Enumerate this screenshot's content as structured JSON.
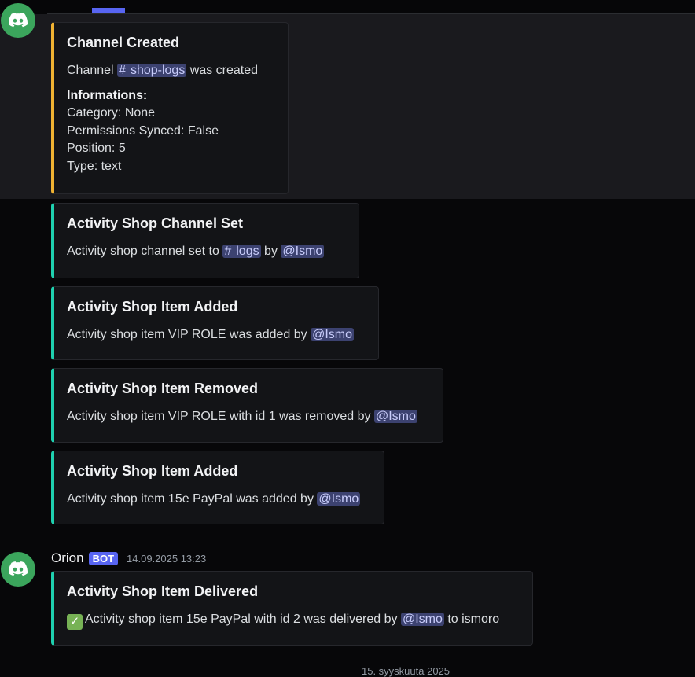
{
  "embeds": [
    {
      "title": "Channel Created",
      "desc_pre": "Channel ",
      "channel": "shop-logs",
      "desc_post": " was created",
      "field_name": "Informations:",
      "field_lines": [
        "Category: None",
        "Permissions Synced: False",
        "Position: 5",
        "Type: text"
      ]
    },
    {
      "title": "Activity Shop Channel Set",
      "desc_pre": "Activity shop channel set to ",
      "channel": "logs",
      "desc_mid": " by ",
      "mention": "@Ismo"
    },
    {
      "title": "Activity Shop Item Added",
      "desc_pre": "Activity shop item VIP ROLE was added by ",
      "mention": "@Ismo"
    },
    {
      "title": "Activity Shop Item Removed",
      "desc_pre": "Activity shop item VIP ROLE with id 1 was removed by ",
      "mention": "@Ismo"
    },
    {
      "title": "Activity Shop Item Added",
      "desc_pre": "Activity shop item 15e PayPal was added by ",
      "mention": "@Ismo"
    }
  ],
  "message": {
    "username": "Orion",
    "bot_tag": "BOT",
    "timestamp": "14.09.2025 13:23",
    "embed": {
      "title": "Activity Shop Item Delivered",
      "check_glyph": "✓",
      "desc_pre": "Activity shop item 15e PayPal with id 2 was delivered by ",
      "mention": "@Ismo",
      "desc_post": " to ismoro"
    }
  },
  "date_divider": "15. syyskuuta 2025",
  "colors": {
    "accent_teal": "#1fd1b0",
    "accent_yellow": "#f0b232",
    "mention_bg": "#3c4270",
    "bot_tag": "#5865f2",
    "avatar": "#3ba55c"
  },
  "icons": [
    "discord-logo-icon",
    "hash-icon",
    "check-mark-icon"
  ]
}
